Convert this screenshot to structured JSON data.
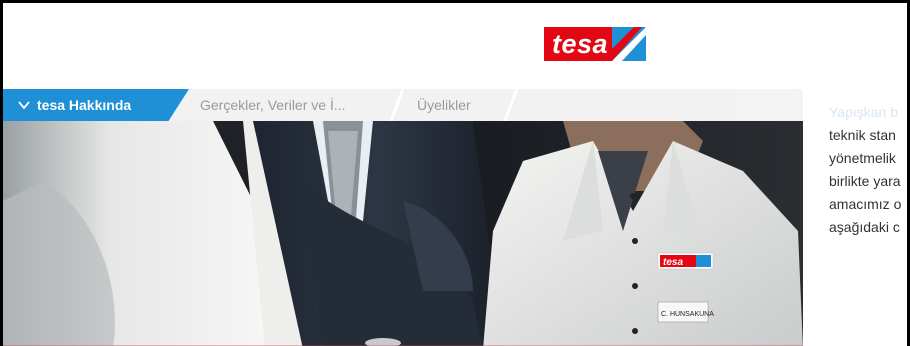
{
  "brand": {
    "logo_text": "tesa",
    "color": "#e30613"
  },
  "nav": {
    "active_tab": "tesa Hakkında",
    "tabs": [
      "Gerçekler, Veriler ve İ...",
      "Üyelikler"
    ],
    "active_color": "#1f8fd6"
  },
  "hero": {
    "badge_text": "tesa",
    "name_tag": "C. HUNSAKUNA"
  },
  "panel": {
    "faded_line": "Yapışkan b",
    "lines": [
      "teknik stan",
      "yönetmelik",
      "birlikte yara",
      "amacımız o",
      "aşağıdaki c"
    ]
  }
}
